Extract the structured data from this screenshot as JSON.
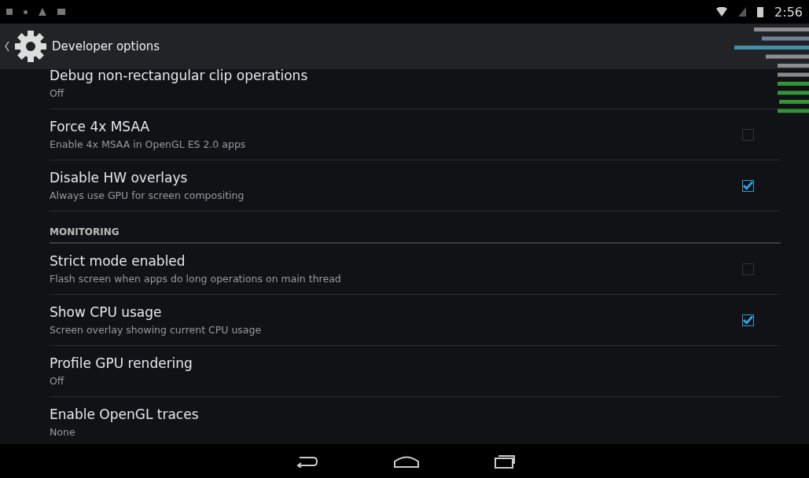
{
  "status_bar": {
    "time": "2:56"
  },
  "action_bar": {
    "title": "Developer options"
  },
  "items": [
    {
      "kind": "setting",
      "title": "Debug non-rectangular clip operations",
      "summary": "Off"
    },
    {
      "kind": "checkbox",
      "title": "Force 4x MSAA",
      "summary": "Enable 4x MSAA in OpenGL ES 2.0 apps",
      "checked": false
    },
    {
      "kind": "checkbox",
      "title": "Disable HW overlays",
      "summary": "Always use GPU for screen compositing",
      "checked": true
    },
    {
      "kind": "header",
      "title": "MONITORING"
    },
    {
      "kind": "checkbox",
      "title": "Strict mode enabled",
      "summary": "Flash screen when apps do long operations on main thread",
      "checked": false
    },
    {
      "kind": "checkbox",
      "title": "Show CPU usage",
      "summary": "Screen overlay showing current CPU usage",
      "checked": true
    },
    {
      "kind": "setting",
      "title": "Profile GPU rendering",
      "summary": "Off"
    },
    {
      "kind": "setting",
      "title": "Enable OpenGL traces",
      "summary": "None"
    }
  ]
}
